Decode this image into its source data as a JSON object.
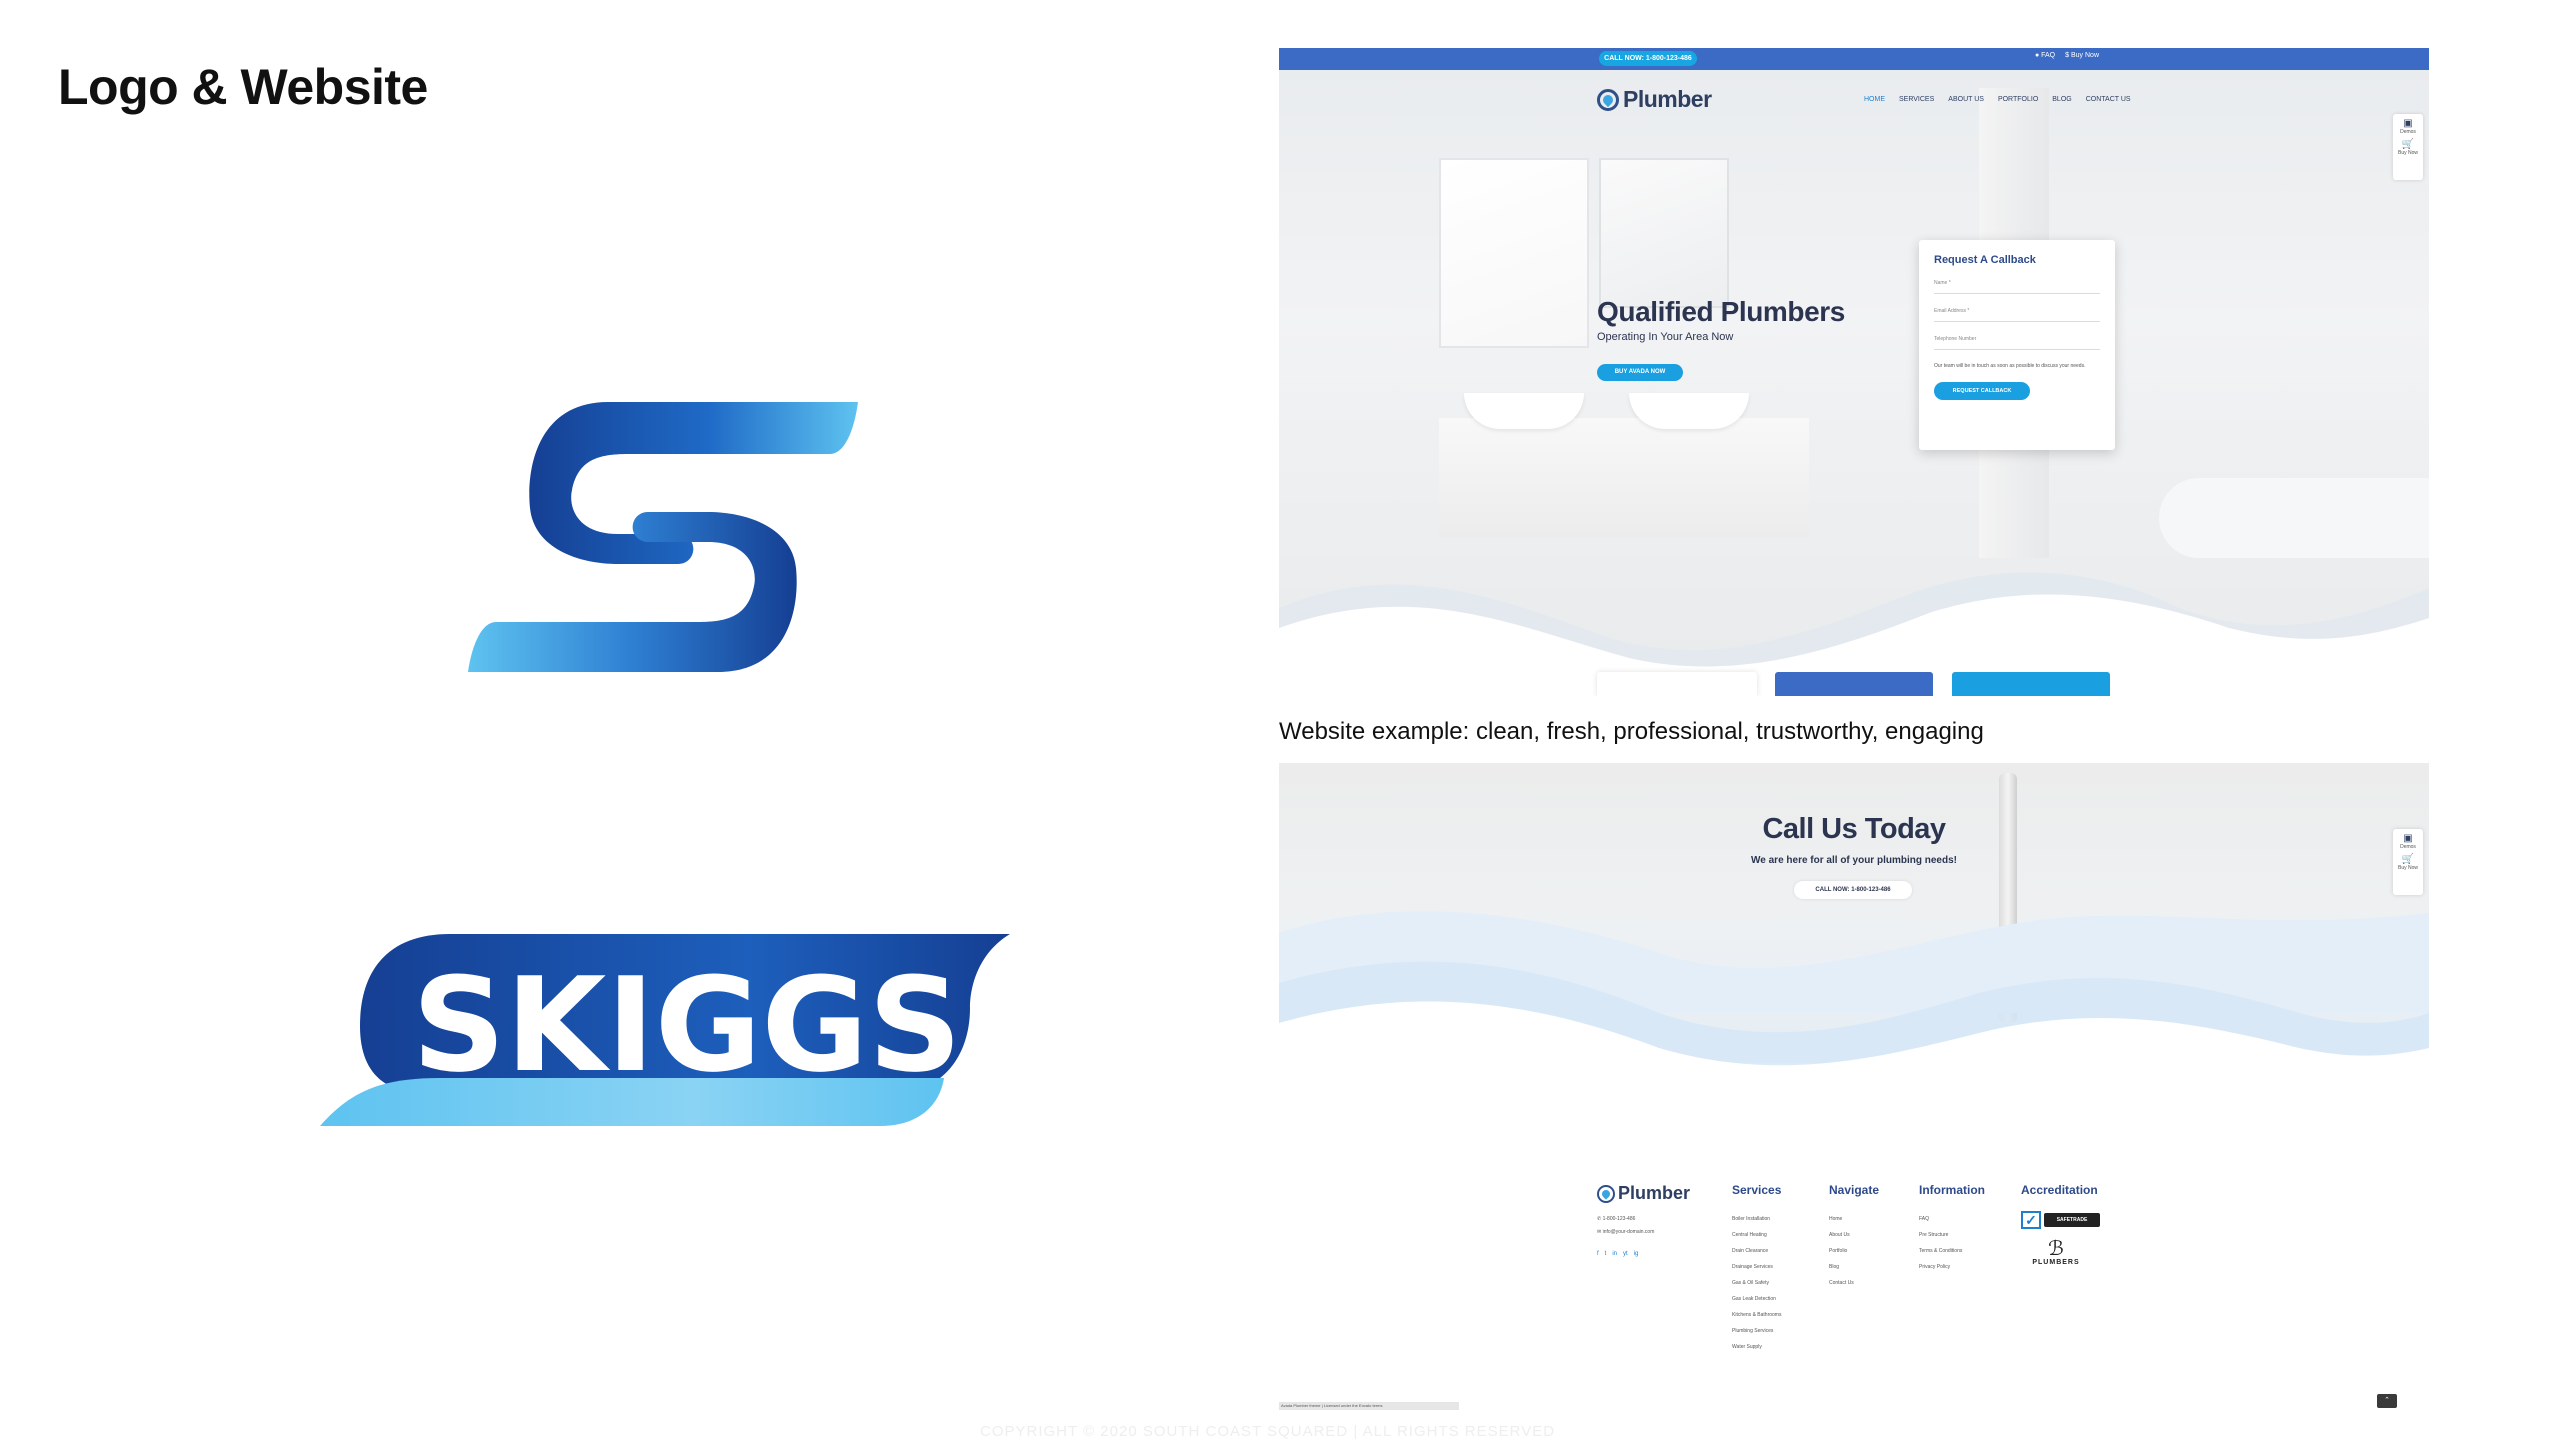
{
  "slide": {
    "title": "Logo & Website",
    "caption": "Website example: clean, fresh, professional, trustworthy, engaging",
    "copyright": "COPYRIGHT © 2020 SOUTH COAST SQUARED | ALL RIGHTS RESERVED"
  },
  "logo": {
    "wordmark": "SKIGGS",
    "colors": {
      "dark_blue": "#153f93",
      "mid_blue": "#1f6bc7",
      "light_blue": "#5ec3f0"
    }
  },
  "site1": {
    "topbar": {
      "call": "CALL NOW: 1-800-123-486",
      "faq": "FAQ",
      "buy": "Buy Now"
    },
    "brand": "Plumber",
    "nav": [
      "HOME",
      "SERVICES",
      "ABOUT US",
      "PORTFOLIO",
      "BLOG",
      "CONTACT US"
    ],
    "widgets": {
      "demos": "Demos",
      "buy": "Buy Now"
    },
    "hero": {
      "title": "Qualified Plumbers",
      "subtitle": "Operating In Your Area Now",
      "button": "BUY AVADA NOW"
    },
    "callback": {
      "title": "Request A Callback",
      "name": "Name *",
      "email": "Email Address *",
      "phone": "Telephone Number",
      "text": "Our team will be in touch as soon as possible to discuss your needs.",
      "button": "REQUEST CALLBACK"
    },
    "colors": {
      "topbar": "#3b6bc4",
      "accent": "#1a9fe0",
      "heading": "#2c3550"
    }
  },
  "site2": {
    "cta": {
      "title": "Call Us Today",
      "subtitle": "We are here for all of your plumbing needs!",
      "button": "CALL NOW: 1-800-123-486"
    },
    "widgets": {
      "demos": "Demos",
      "buy": "Buy Now"
    },
    "footer": {
      "brand": "Plumber",
      "contact": [
        "1-800-123-486",
        "info@your-domain.com"
      ],
      "social": [
        "f",
        "t",
        "in",
        "yt",
        "ig"
      ],
      "columns": [
        {
          "title": "Services",
          "items": [
            "Boiler Installation",
            "Central Heating",
            "Drain Clearance",
            "Drainage Services",
            "Gas & Oil Safety",
            "Gas Leak Detection",
            "Kitchens & Bathrooms",
            "Plumbing Services",
            "Water Supply"
          ]
        },
        {
          "title": "Navigate",
          "items": [
            "Home",
            "About Us",
            "Portfolio",
            "Blog",
            "Contact Us"
          ]
        },
        {
          "title": "Information",
          "items": [
            "FAQ",
            "Pre Structure",
            "Terms & Conditions",
            "Privacy Policy"
          ]
        },
        {
          "title": "Accreditation",
          "items": []
        }
      ],
      "accreditation": {
        "badge1": "SAFETRADE",
        "badge2": "PLUMBERS"
      },
      "note": "Avada Plumber theme | Licensed under the Envato terms"
    }
  }
}
